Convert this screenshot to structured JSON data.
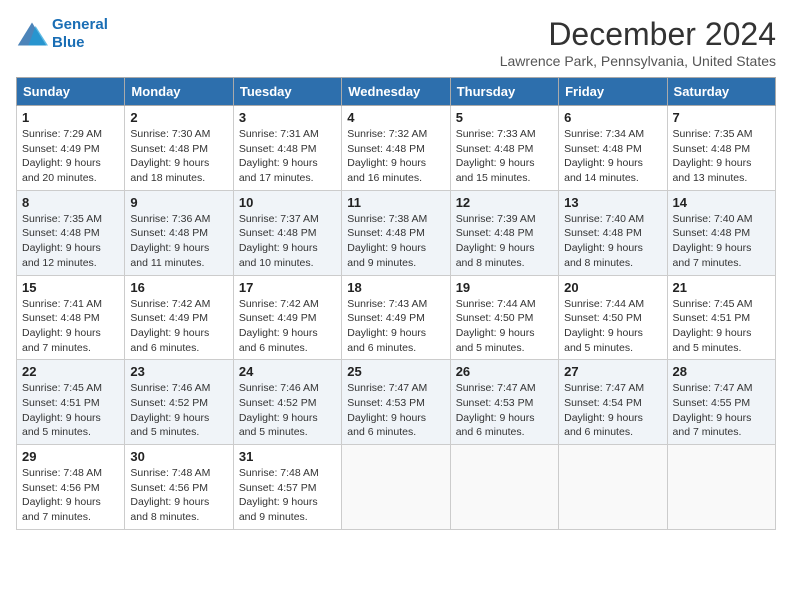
{
  "header": {
    "logo_line1": "General",
    "logo_line2": "Blue",
    "month_title": "December 2024",
    "location": "Lawrence Park, Pennsylvania, United States"
  },
  "weekdays": [
    "Sunday",
    "Monday",
    "Tuesday",
    "Wednesday",
    "Thursday",
    "Friday",
    "Saturday"
  ],
  "weeks": [
    [
      {
        "day": "1",
        "sunrise": "7:29 AM",
        "sunset": "4:49 PM",
        "daylight": "9 hours and 20 minutes."
      },
      {
        "day": "2",
        "sunrise": "7:30 AM",
        "sunset": "4:48 PM",
        "daylight": "9 hours and 18 minutes."
      },
      {
        "day": "3",
        "sunrise": "7:31 AM",
        "sunset": "4:48 PM",
        "daylight": "9 hours and 17 minutes."
      },
      {
        "day": "4",
        "sunrise": "7:32 AM",
        "sunset": "4:48 PM",
        "daylight": "9 hours and 16 minutes."
      },
      {
        "day": "5",
        "sunrise": "7:33 AM",
        "sunset": "4:48 PM",
        "daylight": "9 hours and 15 minutes."
      },
      {
        "day": "6",
        "sunrise": "7:34 AM",
        "sunset": "4:48 PM",
        "daylight": "9 hours and 14 minutes."
      },
      {
        "day": "7",
        "sunrise": "7:35 AM",
        "sunset": "4:48 PM",
        "daylight": "9 hours and 13 minutes."
      }
    ],
    [
      {
        "day": "8",
        "sunrise": "7:35 AM",
        "sunset": "4:48 PM",
        "daylight": "9 hours and 12 minutes."
      },
      {
        "day": "9",
        "sunrise": "7:36 AM",
        "sunset": "4:48 PM",
        "daylight": "9 hours and 11 minutes."
      },
      {
        "day": "10",
        "sunrise": "7:37 AM",
        "sunset": "4:48 PM",
        "daylight": "9 hours and 10 minutes."
      },
      {
        "day": "11",
        "sunrise": "7:38 AM",
        "sunset": "4:48 PM",
        "daylight": "9 hours and 9 minutes."
      },
      {
        "day": "12",
        "sunrise": "7:39 AM",
        "sunset": "4:48 PM",
        "daylight": "9 hours and 8 minutes."
      },
      {
        "day": "13",
        "sunrise": "7:40 AM",
        "sunset": "4:48 PM",
        "daylight": "9 hours and 8 minutes."
      },
      {
        "day": "14",
        "sunrise": "7:40 AM",
        "sunset": "4:48 PM",
        "daylight": "9 hours and 7 minutes."
      }
    ],
    [
      {
        "day": "15",
        "sunrise": "7:41 AM",
        "sunset": "4:48 PM",
        "daylight": "9 hours and 7 minutes."
      },
      {
        "day": "16",
        "sunrise": "7:42 AM",
        "sunset": "4:49 PM",
        "daylight": "9 hours and 6 minutes."
      },
      {
        "day": "17",
        "sunrise": "7:42 AM",
        "sunset": "4:49 PM",
        "daylight": "9 hours and 6 minutes."
      },
      {
        "day": "18",
        "sunrise": "7:43 AM",
        "sunset": "4:49 PM",
        "daylight": "9 hours and 6 minutes."
      },
      {
        "day": "19",
        "sunrise": "7:44 AM",
        "sunset": "4:50 PM",
        "daylight": "9 hours and 5 minutes."
      },
      {
        "day": "20",
        "sunrise": "7:44 AM",
        "sunset": "4:50 PM",
        "daylight": "9 hours and 5 minutes."
      },
      {
        "day": "21",
        "sunrise": "7:45 AM",
        "sunset": "4:51 PM",
        "daylight": "9 hours and 5 minutes."
      }
    ],
    [
      {
        "day": "22",
        "sunrise": "7:45 AM",
        "sunset": "4:51 PM",
        "daylight": "9 hours and 5 minutes."
      },
      {
        "day": "23",
        "sunrise": "7:46 AM",
        "sunset": "4:52 PM",
        "daylight": "9 hours and 5 minutes."
      },
      {
        "day": "24",
        "sunrise": "7:46 AM",
        "sunset": "4:52 PM",
        "daylight": "9 hours and 5 minutes."
      },
      {
        "day": "25",
        "sunrise": "7:47 AM",
        "sunset": "4:53 PM",
        "daylight": "9 hours and 6 minutes."
      },
      {
        "day": "26",
        "sunrise": "7:47 AM",
        "sunset": "4:53 PM",
        "daylight": "9 hours and 6 minutes."
      },
      {
        "day": "27",
        "sunrise": "7:47 AM",
        "sunset": "4:54 PM",
        "daylight": "9 hours and 6 minutes."
      },
      {
        "day": "28",
        "sunrise": "7:47 AM",
        "sunset": "4:55 PM",
        "daylight": "9 hours and 7 minutes."
      }
    ],
    [
      {
        "day": "29",
        "sunrise": "7:48 AM",
        "sunset": "4:56 PM",
        "daylight": "9 hours and 7 minutes."
      },
      {
        "day": "30",
        "sunrise": "7:48 AM",
        "sunset": "4:56 PM",
        "daylight": "9 hours and 8 minutes."
      },
      {
        "day": "31",
        "sunrise": "7:48 AM",
        "sunset": "4:57 PM",
        "daylight": "9 hours and 9 minutes."
      },
      null,
      null,
      null,
      null
    ]
  ]
}
